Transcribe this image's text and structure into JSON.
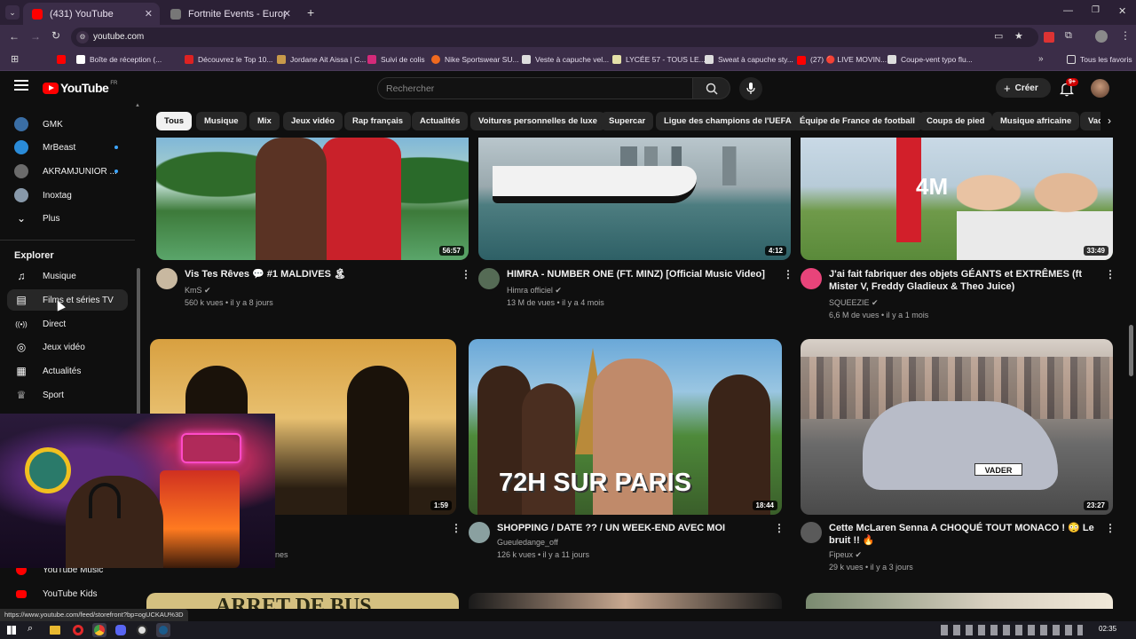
{
  "browser": {
    "tabs": [
      {
        "title": "(431) YouTube",
        "active": true
      },
      {
        "title": "Fortnite Events - Europe - Comp",
        "active": false
      }
    ],
    "url": "youtube.com",
    "bookmarks": [
      "Boîte de réception (...",
      "Découvrez le Top 10...",
      "Jordane Ait Aissa | C...",
      "Suivi de colis",
      "Nike Sportswear SU...",
      "Veste à capuche vel...",
      "LYCÉE 57 - TOUS LE...",
      "Sweat à capuche sty...",
      "(27) 🔴 LIVE MOVIN...",
      "Coupe-vent typo flu..."
    ],
    "all_bookmarks": "Tous les favoris",
    "status_url": "https://www.youtube.com/feed/storefront?bp=ogUCKAU%3D"
  },
  "youtube": {
    "logo": "YouTube",
    "region": "FR",
    "search_placeholder": "Rechercher",
    "create_label": "Créer",
    "notif_count": "9+",
    "subscriptions": [
      {
        "name": "GMK",
        "color": "#3a6ea5",
        "live": false
      },
      {
        "name": "MrBeast",
        "color": "#2a8bd8",
        "live": true
      },
      {
        "name": "AKRAMJUNIOR ...",
        "color": "#6b6b6b",
        "live": true
      },
      {
        "name": "Inoxtag",
        "color": "#8899aa",
        "live": false
      }
    ],
    "more_label": "Plus",
    "explore_title": "Explorer",
    "explore_items": [
      {
        "label": "Musique",
        "icon": "music-note-icon",
        "glyph": "♫"
      },
      {
        "label": "Films et séries TV",
        "icon": "clapperboard-icon",
        "glyph": "▤"
      },
      {
        "label": "Direct",
        "icon": "live-broadcast-icon",
        "glyph": "((•))"
      },
      {
        "label": "Jeux vidéo",
        "icon": "gamepad-icon",
        "glyph": "◎"
      },
      {
        "label": "Actualités",
        "icon": "newspaper-icon",
        "glyph": "▦"
      },
      {
        "label": "Sport",
        "icon": "trophy-icon",
        "glyph": "♕"
      }
    ],
    "more_yt": [
      {
        "label": "YouTube Music"
      },
      {
        "label": "YouTube Kids"
      }
    ],
    "chips": [
      "Tous",
      "Musique",
      "Mix",
      "Jeux vidéo",
      "Rap français",
      "Actualités",
      "Voitures personnelles de luxe",
      "Supercar",
      "Ligue des champions de l'UEFA",
      "Équipe de France de football",
      "Coups de pied",
      "Musique africaine",
      "Vac"
    ],
    "videos_row1": [
      {
        "title": "Vis Tes Rêves 💬 #1 MALDIVES 🏝",
        "channel": "KmS",
        "meta": "560 k vues • il y a 8 jours",
        "duration": "56:57"
      },
      {
        "title": "HIMRA - NUMBER ONE (FT. MINZ) [Official Music Video]",
        "channel": "Himra officiel",
        "meta": "13 M de vues • il y a 4 mois",
        "duration": "4:12"
      },
      {
        "title": "J'ai fait fabriquer des objets GÉANTS et EXTRÊMES (ft Mister V, Freddy Gladieux & Theo Juice)",
        "channel": "SQUEEZIE",
        "meta": "6,6 M de vues • il y a 1 mois",
        "duration": "33:49"
      }
    ],
    "videos_row2": [
      {
        "title": "",
        "channel": "",
        "meta": "nes",
        "duration": "1:59"
      },
      {
        "title": "SHOPPING / DATE ?? / UN WEEK-END AVEC MOI",
        "channel": "Gueuledange_off",
        "meta": "126 k vues • il y a 11 jours",
        "duration": "18:44",
        "overlay": "72H SUR PARIS"
      },
      {
        "title": "Cette McLaren Senna A CHOQUÉ TOUT MONACO ! 😳 Le bruit !! 🔥",
        "channel": "Fipeux",
        "meta": "29 k vues • il y a 3 jours",
        "duration": "23:27",
        "plate": "VADER"
      }
    ],
    "row3_thumb_text": "ARRET DE BUS"
  },
  "taskbar": {
    "time": "02:35"
  }
}
